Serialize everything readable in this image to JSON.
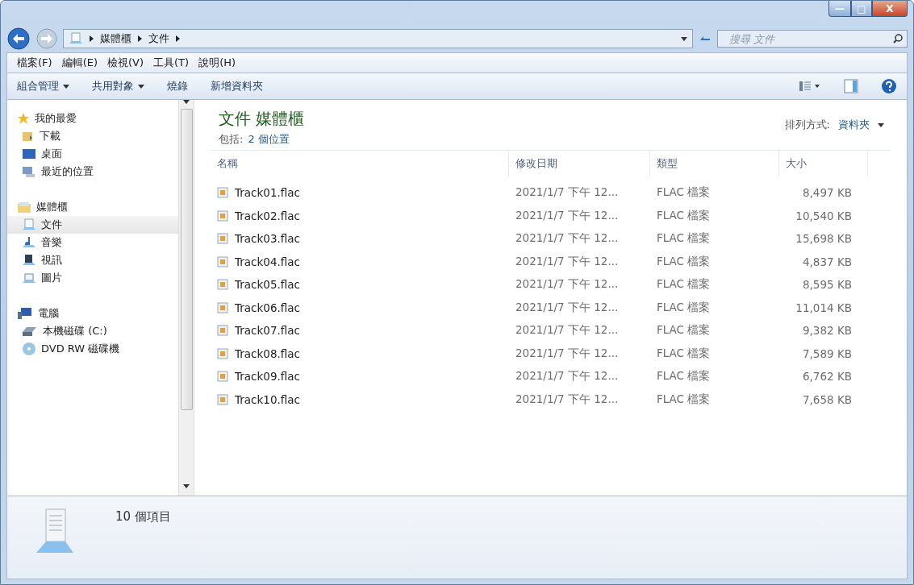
{
  "window": {
    "buttons": [
      "—",
      "□",
      "X"
    ]
  },
  "address": {
    "crumbs": [
      "媒體櫃",
      "文件"
    ],
    "search_placeholder": "搜尋 文件"
  },
  "menu": [
    "檔案(F)",
    "編輯(E)",
    "檢視(V)",
    "工具(T)",
    "說明(H)"
  ],
  "commands": [
    {
      "label": "組合管理",
      "dropdown": true
    },
    {
      "label": "共用對象",
      "dropdown": true
    },
    {
      "label": "燒錄",
      "dropdown": false
    },
    {
      "label": "新增資料夾",
      "dropdown": false
    }
  ],
  "sidebar": [
    {
      "label": "我的最愛",
      "children": [
        {
          "label": "下載",
          "selected": false
        },
        {
          "label": "桌面",
          "selected": false
        },
        {
          "label": "最近的位置",
          "selected": false
        }
      ]
    },
    {
      "label": "媒體櫃",
      "children": [
        {
          "label": "文件",
          "selected": true
        },
        {
          "label": "音樂",
          "selected": false
        },
        {
          "label": "視訊",
          "selected": false
        },
        {
          "label": "圖片",
          "selected": false
        }
      ]
    },
    {
      "label": "電腦",
      "children": [
        {
          "label": "本機磁碟 (C:)",
          "selected": false
        },
        {
          "label": "DVD RW 磁碟機",
          "selected": false
        }
      ]
    }
  ],
  "library": {
    "title": "文件 媒體櫃",
    "includes_label": "包括:",
    "includes_link": "2 個位置",
    "arrange_label": "排列方式:",
    "arrange_value": "資料夾"
  },
  "table": {
    "columns": [
      "名稱",
      "修改日期",
      "類型",
      "大小"
    ],
    "rows": [
      {
        "name": "Track01.flac",
        "modified": "2021/1/7 下午 12...",
        "type": "FLAC 檔案",
        "size": "8,497 KB"
      },
      {
        "name": "Track02.flac",
        "modified": "2021/1/7 下午 12...",
        "type": "FLAC 檔案",
        "size": "10,540 KB"
      },
      {
        "name": "Track03.flac",
        "modified": "2021/1/7 下午 12...",
        "type": "FLAC 檔案",
        "size": "15,698 KB"
      },
      {
        "name": "Track04.flac",
        "modified": "2021/1/7 下午 12...",
        "type": "FLAC 檔案",
        "size": "4,837 KB"
      },
      {
        "name": "Track05.flac",
        "modified": "2021/1/7 下午 12...",
        "type": "FLAC 檔案",
        "size": "8,595 KB"
      },
      {
        "name": "Track06.flac",
        "modified": "2021/1/7 下午 12...",
        "type": "FLAC 檔案",
        "size": "11,014 KB"
      },
      {
        "name": "Track07.flac",
        "modified": "2021/1/7 下午 12...",
        "type": "FLAC 檔案",
        "size": "9,382 KB"
      },
      {
        "name": "Track08.flac",
        "modified": "2021/1/7 下午 12...",
        "type": "FLAC 檔案",
        "size": "7,589 KB"
      },
      {
        "name": "Track09.flac",
        "modified": "2021/1/7 下午 12...",
        "type": "FLAC 檔案",
        "size": "6,762 KB"
      },
      {
        "name": "Track10.flac",
        "modified": "2021/1/7 下午 12...",
        "type": "FLAC 檔案",
        "size": "7,658 KB"
      }
    ]
  },
  "status_bar": {
    "count": "10 個項目"
  }
}
